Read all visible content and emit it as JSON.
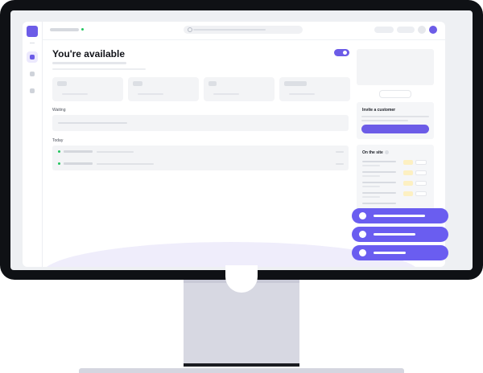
{
  "main": {
    "title": "You're available",
    "waiting_label": "Waiting",
    "today_label": "Today"
  },
  "sidebar_panel": {
    "invite_title": "Invite a customer",
    "on_site_title": "On the site"
  },
  "colors": {
    "accent": "#6c5ce7",
    "status_online": "#22c55e",
    "bezel": "#0f1115"
  }
}
